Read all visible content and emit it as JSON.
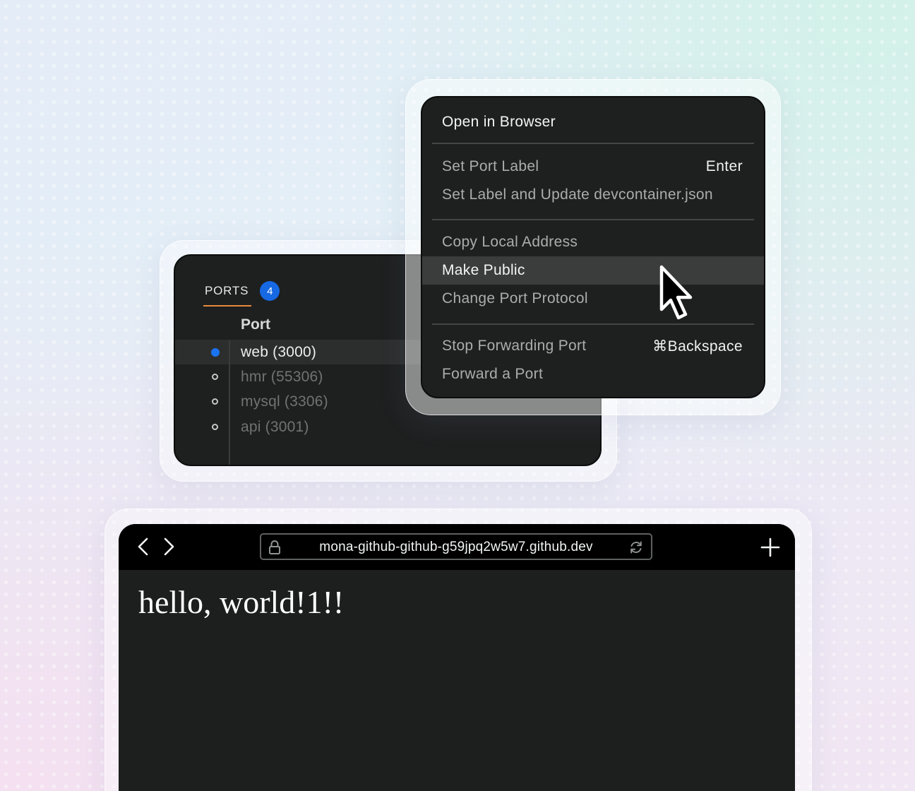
{
  "ports_panel": {
    "tab_label": "PORTS",
    "badge_count": "4",
    "column_header": "Port",
    "ports": [
      {
        "label": "web (3000)",
        "active": true
      },
      {
        "label": "hmr (55306)",
        "active": false
      },
      {
        "label": "mysql (3306)",
        "active": false
      },
      {
        "label": "api (3001)",
        "active": false
      }
    ]
  },
  "context_menu": {
    "items": [
      {
        "label": "Open in Browser",
        "shortcut": ""
      },
      {
        "label": "Set Port Label",
        "shortcut": "Enter"
      },
      {
        "label": "Set Label and Update devcontainer.json",
        "shortcut": ""
      },
      {
        "label": "Copy Local Address",
        "shortcut": ""
      },
      {
        "label": "Make Public",
        "shortcut": ""
      },
      {
        "label": "Change Port Protocol",
        "shortcut": ""
      },
      {
        "label": "Stop Forwarding Port",
        "shortcut": "⌘Backspace"
      },
      {
        "label": "Forward a Port",
        "shortcut": ""
      }
    ],
    "highlighted_item": "Make Public"
  },
  "browser": {
    "url": "mona-github-github-g59jpq2w5w7.github.dev",
    "page_text": "hello, world!1!!"
  },
  "icons": {
    "back": "chevron-left-icon",
    "forward": "chevron-right-icon",
    "lock": "lock-icon",
    "reload": "reload-icon",
    "new_tab": "plus-icon",
    "pointer": "mouse-pointer-icon"
  },
  "colors": {
    "panel_bg": "#1e2020",
    "badge_blue": "#1668e3",
    "tab_underline": "#e88a3a",
    "highlight_row": "#3a3d3c"
  }
}
